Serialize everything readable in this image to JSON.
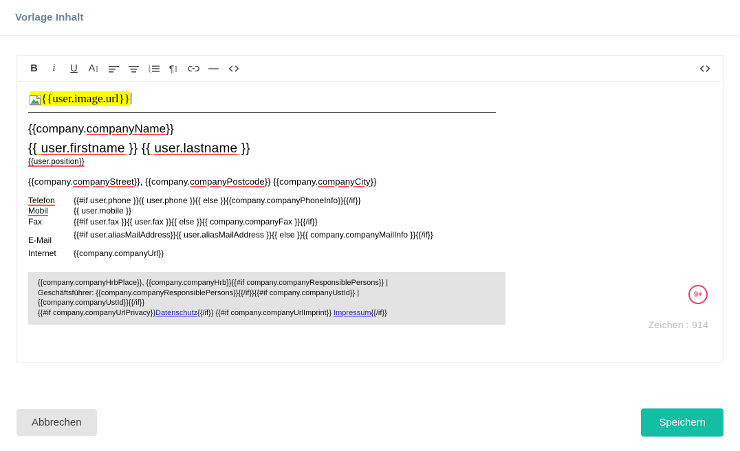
{
  "header": {
    "title": "Vorlage Inhalt"
  },
  "toolbar": {
    "bold_label": "B",
    "italic_label": "i",
    "underline_label": "U",
    "fontsize_label": "A",
    "items": [
      {
        "name": "bold-button",
        "label": "B"
      },
      {
        "name": "italic-button",
        "label": "i"
      },
      {
        "name": "underline-button",
        "label": "U"
      },
      {
        "name": "font-size-button",
        "label": "A"
      },
      {
        "name": "align-left-button",
        "label": ""
      },
      {
        "name": "align-center-button",
        "label": ""
      },
      {
        "name": "ordered-list-button",
        "label": ""
      },
      {
        "name": "paragraph-format-button",
        "label": ""
      },
      {
        "name": "insert-link-button",
        "label": ""
      },
      {
        "name": "horizontal-rule-button",
        "label": ""
      },
      {
        "name": "code-view-button",
        "label": ""
      }
    ],
    "source_view_icon": "code-icon"
  },
  "editor": {
    "image_placeholder_icon": "broken-image-icon",
    "image_token": "{{user.image.url}}",
    "company_line": {
      "pre": "{{company.",
      "var": "companyName",
      "post": "}}"
    },
    "name_line": {
      "first_pre": "{{",
      "first_sp": " ",
      "first_var": "user.firstname",
      "first_post": " }}",
      "sep": " ",
      "last_pre": "{{",
      "last_var": "user.lastname",
      "last_post": " }}"
    },
    "position_line": "{{user.position}}",
    "address_line": {
      "street_pre": "{{company.",
      "street_var": "companyStreet",
      "street_post": "}}, ",
      "postcode_pre": "{{company.",
      "postcode_var": "companyPostcode",
      "postcode_post": "}} ",
      "city_pre": "{{company.",
      "city_var": "companyCity",
      "city_post": "}}"
    },
    "contact_rows": [
      {
        "label": "Telefon",
        "value": "{{#if user.phone }}{{ user.phone }}{{ else }}{{company.companyPhoneInfo}}{{/if}}"
      },
      {
        "label": "Mobil",
        "value": "{{ user.mobile }}"
      },
      {
        "label": "Fax",
        "value": "{{#if user.fax }}{{ user.fax }}{{ else }}{{ company.companyFax }}{{/if}}"
      },
      {
        "label": "E-Mail",
        "value": "{{#if user.aliasMailAddress}}{{ user.aliasMailAddress }}{{ else }}{{ company.companyMailInfo }}{{/if}}"
      },
      {
        "label": "Internet",
        "value": "{{company.companyUrl}}"
      }
    ],
    "legal_lines": [
      "{{company.companyHrbPlace}}, {{company.companyHrb}}{{#if company.companyResponsiblePersons}} |",
      "Geschäftsführer: {{company.companyResponsiblePersons}}{{/if}}{{#if company.companyUstId}} |",
      "{{company.companyUstId}}{{/if}}",
      "{{#if company.companyUrlPrivacy}}"
    ],
    "legal_link_privacy": "Datenschutz",
    "legal_mid": "{{/if}} {{#if company.companyUrlImprint}} ",
    "legal_link_imprint": "Impressum",
    "legal_end": "{{/if}}"
  },
  "status": {
    "warning_badge": "9+",
    "char_count_label": "Zeichen : 914"
  },
  "footer": {
    "cancel_label": "Abbrechen",
    "save_label": "Speichern"
  },
  "colors": {
    "accent_teal": "#12bfa4",
    "title_blue_gray": "#6b8299",
    "badge_red": "#ef3e62",
    "highlight_yellow": "#ffff00",
    "link_blue": "#2222dd",
    "legal_background": "#e3e3e3"
  }
}
